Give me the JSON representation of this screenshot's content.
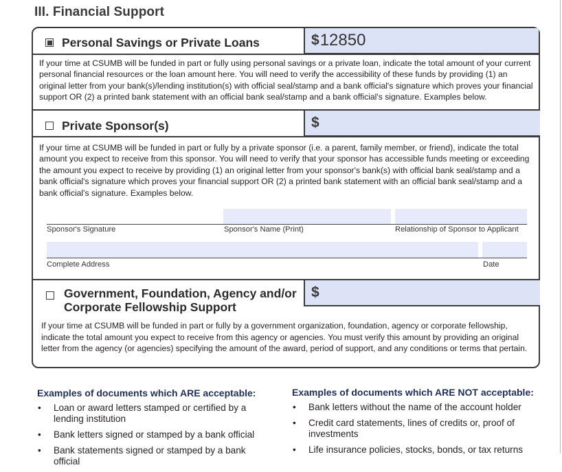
{
  "section": {
    "title": "III. Financial Support"
  },
  "savings": {
    "checked": true,
    "label": "Personal Savings or Private Loans",
    "currency": "$",
    "amount": "12850",
    "description": "If your time at CSUMB will be funded in part or fully using personal savings or a private loan, indicate the total amount of your current personal financial resources or the loan amount here. You will need to verify the accessibility of these funds by providing (1) an original letter from your bank(s)/lending institution(s) with official seal/stamp and a bank official's signature which proves your financial support OR (2) a printed bank statement with an official bank seal/stamp and a bank official's signature. Examples below."
  },
  "sponsor": {
    "checked": false,
    "label": "Private Sponsor(s)",
    "currency": "$",
    "amount": "",
    "description": "If your time at CSUMB will be funded in part or fully by a private sponsor (i.e. a parent, family member, or friend), indicate the total amount you expect to receive from this sponsor. You will need to verify that your sponsor has accessible funds meeting or exceeding the amount you expect to receive by providing (1) an original letter from your sponsor's bank(s) with official bank seal/stamp and a bank official's signature which proves your financial support OR (2) a printed bank statement with an official bank seal/stamp and a bank official's signature. Examples below.",
    "fields": {
      "signature": "Sponsor's Signature",
      "name": "Sponsor's Name (Print)",
      "relationship": "Relationship of Sponsor to Applicant",
      "address": "Complete Address",
      "date": "Date"
    }
  },
  "government": {
    "checked": false,
    "label_line1": "Government, Foundation, Agency and/or",
    "label_line2": "Corporate Fellowship Support",
    "currency": "$",
    "amount": "",
    "description": "If your time at CSUMB will be funded in part or fully by a government organization, foundation, agency or corporate fellowship, indicate the total amount you expect to receive from this agency or agencies. You must verify this amount by providing an original letter from the agency (or agencies) specifying the amount of the award, period of support, and any conditions or terms that pertain."
  },
  "examples": {
    "acceptable": {
      "title": "Examples of documents which ARE acceptable:",
      "items": [
        "Loan or award letters stamped or certified by a lending institution",
        "Bank letters signed or stamped by a bank official",
        "Bank statements signed or stamped by a bank official"
      ]
    },
    "not_acceptable": {
      "title": "Examples of documents which ARE NOT acceptable:",
      "items": [
        "Bank letters without the name of the account holder",
        "Credit card statements, lines of credits or, proof of investments",
        "Life insurance policies, stocks, bonds, or tax returns"
      ]
    },
    "bullet": "•"
  }
}
